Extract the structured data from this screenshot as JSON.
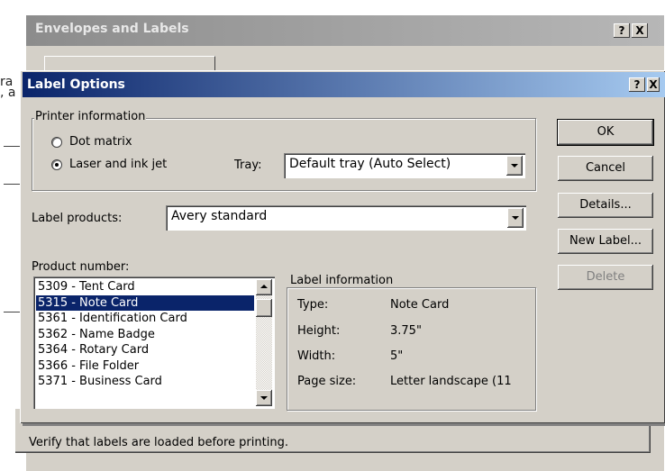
{
  "background_dialog": {
    "title": "Envelopes and Labels",
    "help_label": "?",
    "close_label": "X",
    "footer_text": "Verify that labels are loaded before printing."
  },
  "doc_fragments": [
    "ra",
    ", a"
  ],
  "dialog": {
    "title": "Label Options",
    "help_label": "?",
    "close_label": "X",
    "printer_info": {
      "legend": "Printer information",
      "options": [
        {
          "label": "Dot matrix",
          "selected": false
        },
        {
          "label": "Laser and ink jet",
          "selected": true
        }
      ],
      "tray_label": "Tray:",
      "tray_value": "Default tray (Auto Select)"
    },
    "label_products": {
      "label": "Label products:",
      "value": "Avery standard"
    },
    "product_number": {
      "label": "Product number:",
      "items": [
        "5309 - Tent Card",
        "5315 - Note Card",
        "5361 - Identification Card",
        "5362 - Name Badge",
        "5364 - Rotary Card",
        "5366 - File Folder",
        "5371 - Business Card"
      ],
      "selected_index": 1
    },
    "label_information": {
      "legend": "Label information",
      "rows": [
        {
          "label": "Type:",
          "value": "Note Card"
        },
        {
          "label": "Height:",
          "value": "3.75\""
        },
        {
          "label": "Width:",
          "value": "5\""
        },
        {
          "label": "Page size:",
          "value": "Letter landscape (11"
        }
      ]
    },
    "buttons": {
      "ok": "OK",
      "cancel": "Cancel",
      "details": "Details...",
      "new_label": "New Label...",
      "delete": "Delete"
    }
  },
  "colors": {
    "title_active": "#0a246a",
    "title_inactive": "#8c8c8c",
    "face": "#d4d0c8",
    "selection": "#0a246a"
  }
}
